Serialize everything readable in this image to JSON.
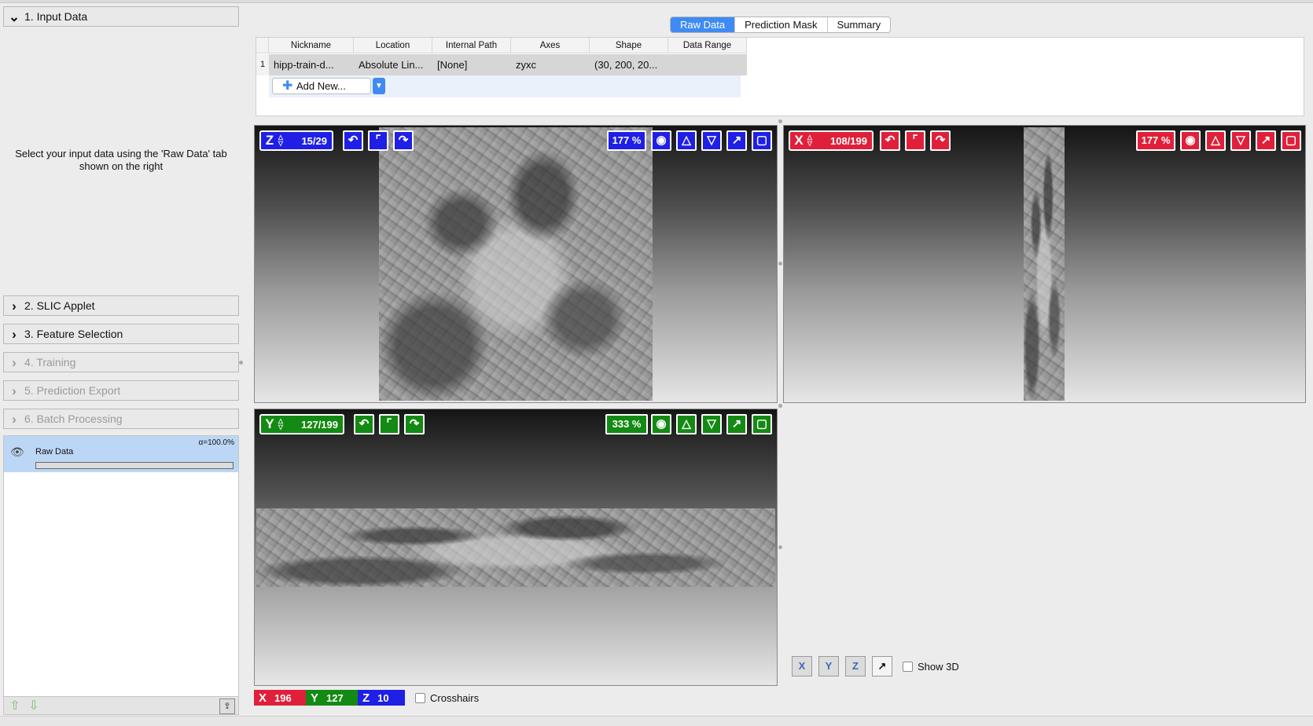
{
  "applets": [
    {
      "label": "1. Input Data",
      "expanded": true,
      "enabled": true
    },
    {
      "label": "2. SLIC Applet",
      "expanded": false,
      "enabled": true
    },
    {
      "label": "3. Feature Selection",
      "expanded": false,
      "enabled": true
    },
    {
      "label": "4. Training",
      "expanded": false,
      "enabled": false
    },
    {
      "label": "5. Prediction Export",
      "expanded": false,
      "enabled": false
    },
    {
      "label": "6. Batch Processing",
      "expanded": false,
      "enabled": false
    }
  ],
  "input_help": "Select your input data using the 'Raw Data' tab shown on the right",
  "layers": [
    {
      "name": "Raw Data",
      "opacity": "α=100.0%",
      "visible": true
    }
  ],
  "tabs": [
    {
      "label": "Raw Data",
      "active": true
    },
    {
      "label": "Prediction Mask",
      "active": false
    },
    {
      "label": "Summary",
      "active": false
    }
  ],
  "table": {
    "columns": [
      "Nickname",
      "Location",
      "Internal Path",
      "Axes",
      "Shape",
      "Data Range"
    ],
    "rows": [
      {
        "index": "1",
        "cells": [
          "hipp-train-d...",
          "Absolute Lin...",
          "[None]",
          "zyxc",
          "(30, 200, 20...",
          ""
        ]
      }
    ],
    "add_button": "Add New..."
  },
  "viewers": {
    "z": {
      "axis": "Z",
      "slice": "15/29",
      "zoom": "177 %",
      "color": "#1f1fe6"
    },
    "x": {
      "axis": "X",
      "slice": "108/199",
      "zoom": "177 %",
      "color": "#e0203a"
    },
    "y": {
      "axis": "Y",
      "slice": "127/199",
      "zoom": "333 %",
      "color": "#138a13"
    }
  },
  "position": {
    "x_label": "X",
    "x": "196",
    "y_label": "Y",
    "y": "127",
    "z_label": "Z",
    "z": "10"
  },
  "crosshairs_label": "Crosshairs",
  "show3d_label": "Show 3D",
  "view_buttons": [
    "X",
    "Y",
    "Z",
    "↗"
  ]
}
